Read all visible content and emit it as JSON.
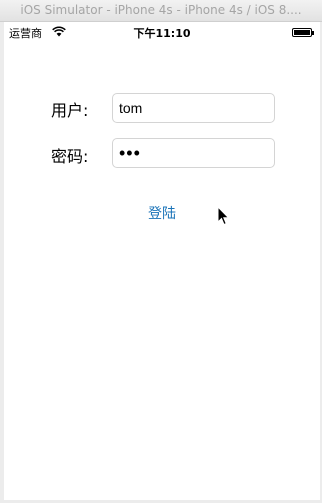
{
  "window": {
    "title": "iOS Simulator - iPhone 4s - iPhone 4s / iOS 8...."
  },
  "status_bar": {
    "carrier": "运营商",
    "time": "下午11:10",
    "wifi_icon": "wifi-icon",
    "battery_icon": "battery-icon"
  },
  "login_form": {
    "username_label": "用户:",
    "username_value": "tom",
    "password_label": "密码:",
    "password_value": "•••",
    "login_label": "登陆"
  },
  "colors": {
    "link_blue": "#1a73b8",
    "field_border": "#d4d4d4",
    "title_text": "#a5a5a5"
  }
}
